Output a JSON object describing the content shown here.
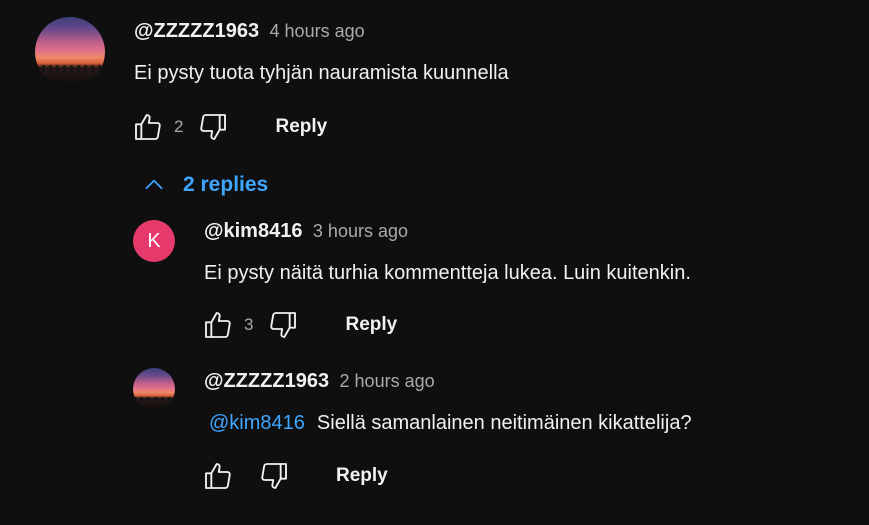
{
  "thread": {
    "top_comment": {
      "author": "@ZZZZZ1963",
      "time": "4 hours ago",
      "text": "Ei pysty tuota tyhjän nauramista kuunnella",
      "likes": "2",
      "reply_label": "Reply"
    },
    "replies_toggle": {
      "label": "2 replies",
      "icon": "chevron-up-icon"
    },
    "replies": [
      {
        "author": "@kim8416",
        "avatar_letter": "K",
        "avatar_color": "#e53a6b",
        "time": "3 hours ago",
        "text": "Ei pysty näitä turhia kommentteja lukea. Luin kuitenkin.",
        "likes": "3",
        "reply_label": "Reply"
      },
      {
        "author": "@ZZZZZ1963",
        "time": "2 hours ago",
        "mention": "@kim8416",
        "text": "Siellä samanlainen neitimäinen kikattelija?",
        "likes": "",
        "reply_label": "Reply"
      }
    ]
  },
  "colors": {
    "background": "#0f0f0f",
    "link": "#3ea6ff",
    "secondary_text": "#aaaaaa"
  }
}
